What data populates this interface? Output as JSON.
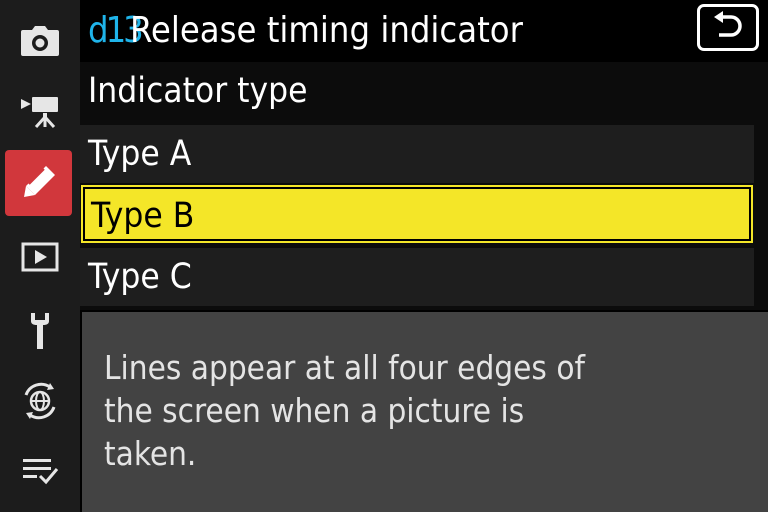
{
  "sidebar": {
    "items": [
      {
        "icon": "camera-icon",
        "name": "photo-shooting-menu"
      },
      {
        "icon": "movie-camera-icon",
        "name": "movie-recording-menu"
      },
      {
        "icon": "pencil-icon",
        "name": "custom-settings-menu",
        "active": true
      },
      {
        "icon": "playback-icon",
        "name": "playback-menu"
      },
      {
        "icon": "wrench-icon",
        "name": "setup-menu"
      },
      {
        "icon": "network-icon",
        "name": "network-menu"
      },
      {
        "icon": "my-menu-icon",
        "name": "my-menu"
      }
    ],
    "active_color": "#d1373c"
  },
  "header": {
    "code": "d13",
    "title": "Release timing indicator",
    "code_color": "#1fb4ea",
    "back_icon": "back-arrow-icon"
  },
  "menu": {
    "heading": "Indicator type",
    "options": [
      "Type A",
      "Type B",
      "Type C"
    ],
    "selected": "Type B",
    "highlight_color": "#f4e628"
  },
  "description": "Lines appear at all four edges of the screen when a picture is taken."
}
